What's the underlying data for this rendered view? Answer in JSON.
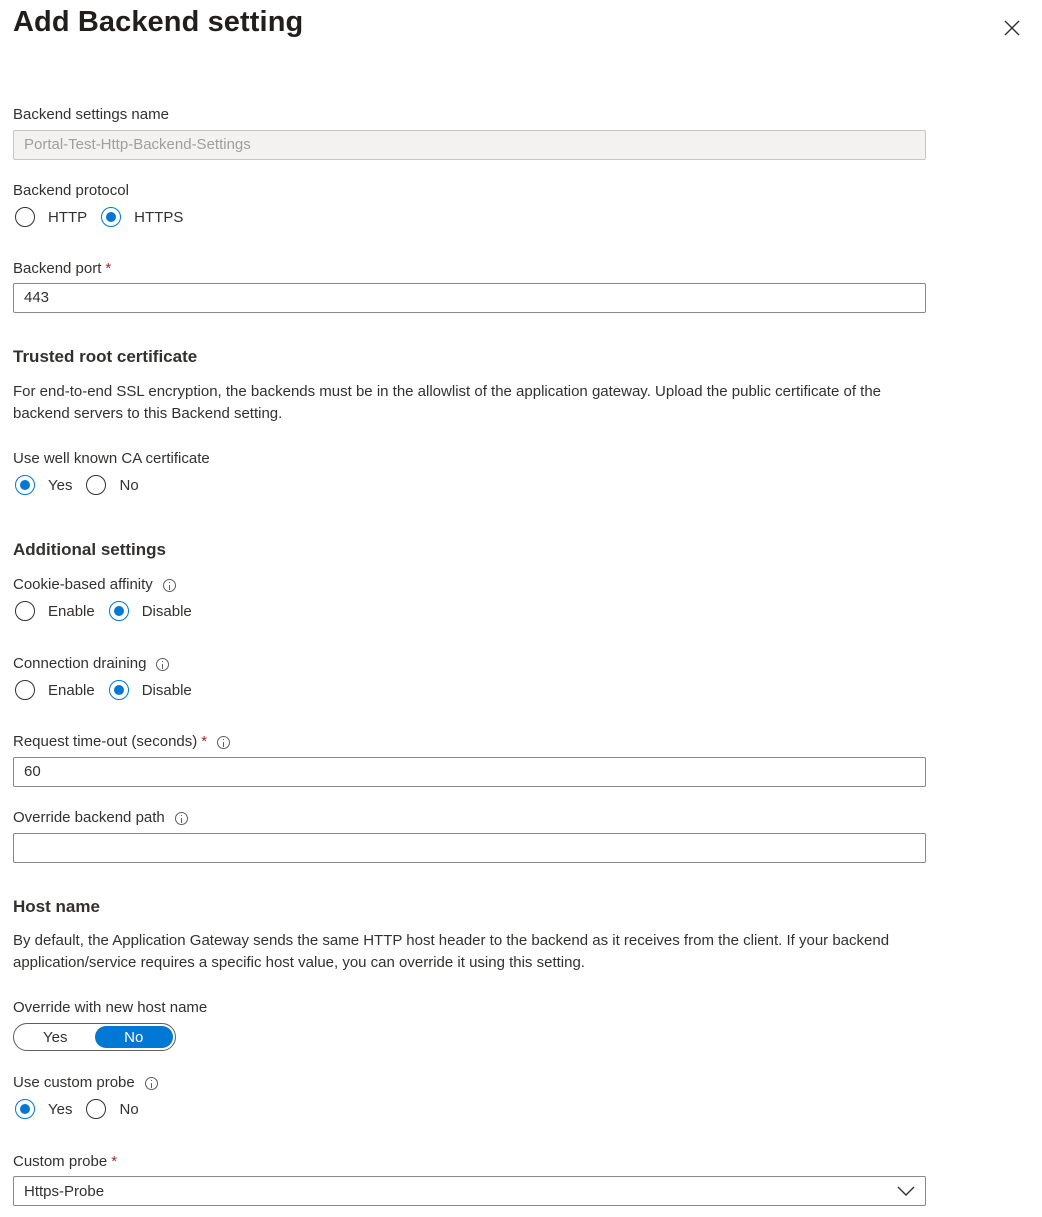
{
  "panel": {
    "title": "Add Backend setting"
  },
  "backend_settings_name": {
    "label": "Backend settings name",
    "value": "Portal-Test-Http-Backend-Settings"
  },
  "backend_protocol": {
    "label": "Backend protocol",
    "options": [
      "HTTP",
      "HTTPS"
    ],
    "selected": "HTTPS"
  },
  "backend_port": {
    "label": "Backend port",
    "required_mark": "*",
    "value": "443"
  },
  "trusted_root": {
    "heading": "Trusted root certificate",
    "description": "For end-to-end SSL encryption, the backends must be in the allowlist of the application gateway. Upload the public certificate of the backend servers to this Backend setting.",
    "use_ca_label": "Use well known CA certificate",
    "options": [
      "Yes",
      "No"
    ],
    "selected": "Yes"
  },
  "additional": {
    "heading": "Additional settings",
    "cookie_affinity": {
      "label": "Cookie-based affinity",
      "options": [
        "Enable",
        "Disable"
      ],
      "selected": "Disable"
    },
    "connection_draining": {
      "label": "Connection draining",
      "options": [
        "Enable",
        "Disable"
      ],
      "selected": "Disable"
    },
    "request_timeout": {
      "label": "Request time-out (seconds)",
      "required_mark": "*",
      "value": "60"
    },
    "override_path": {
      "label": "Override backend path",
      "value": ""
    }
  },
  "host_name": {
    "heading": "Host name",
    "description": "By default, the Application Gateway sends the same HTTP host header to the backend as it receives from the client. If your backend application/service requires a specific host value, you can override it using this setting.",
    "override_label": "Override with new host name",
    "toggle_options": [
      "Yes",
      "No"
    ],
    "toggle_selected": "No",
    "custom_probe_label": "Use custom probe",
    "custom_probe_options": [
      "Yes",
      "No"
    ],
    "custom_probe_selected": "Yes",
    "probe_select_label": "Custom probe",
    "required_mark": "*",
    "probe_select_value": "Https-Probe"
  },
  "colors": {
    "accent": "#0078d4",
    "required": "#a4262c",
    "text": "#323130"
  }
}
